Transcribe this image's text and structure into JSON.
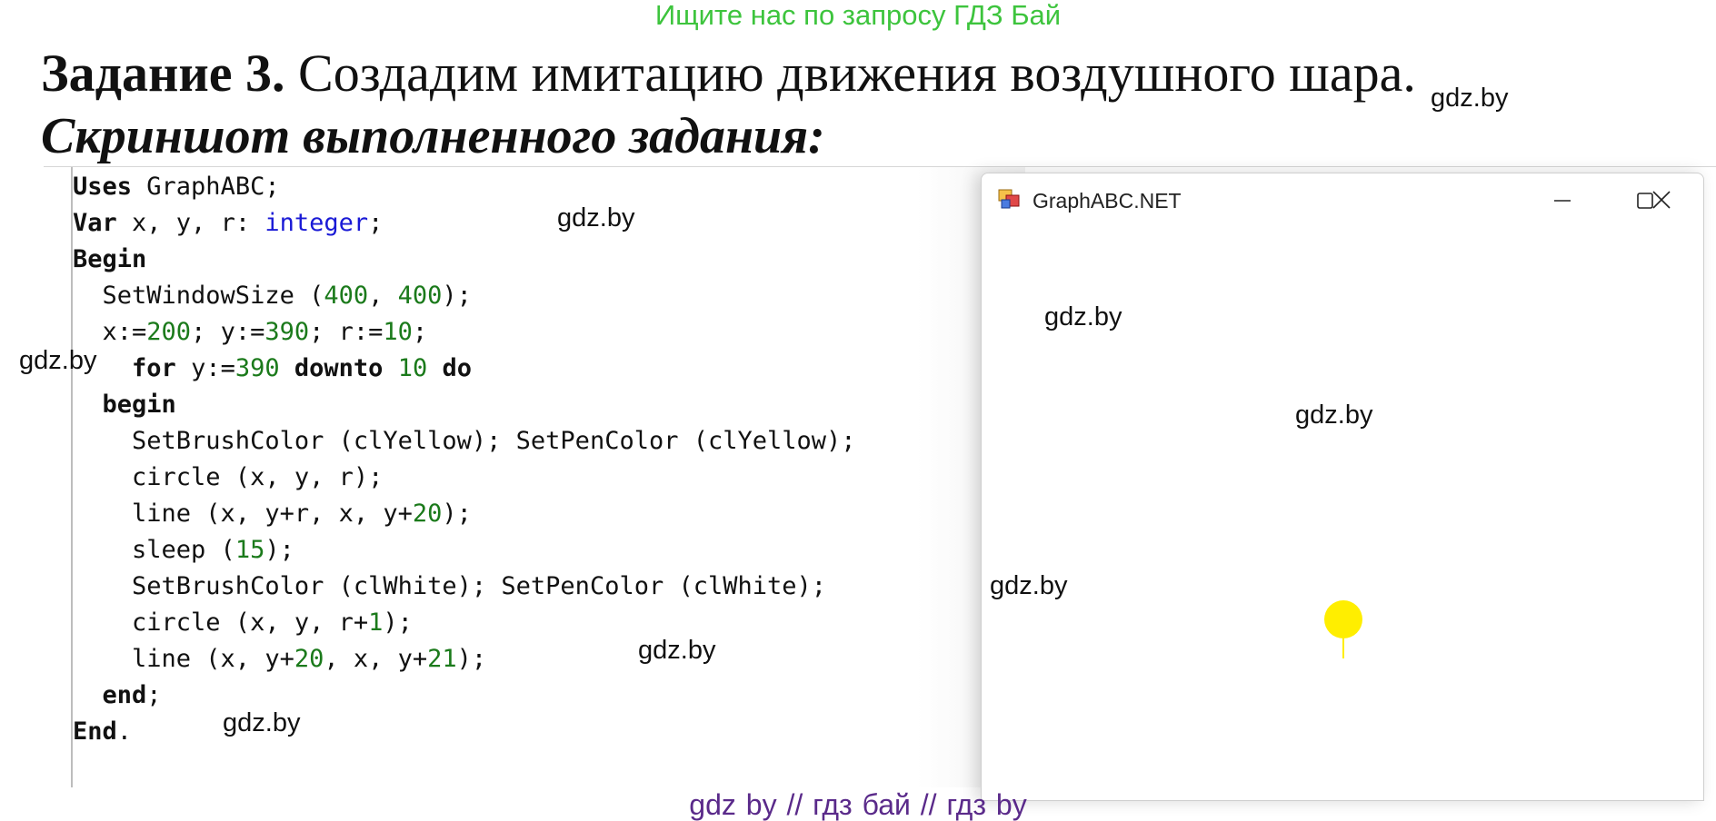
{
  "banner": "Ищите нас по запросу ГДЗ Бай",
  "heading": {
    "bold": "Задание 3.",
    "text": " Создадим имитацию движения воздушного шара."
  },
  "subheading": "Скриншот выполненного задания:",
  "watermark": "gdz.by",
  "footer": "gdz by  //  гдз бай  //  гдз by",
  "editor": {
    "lines": [
      [
        {
          "t": "Uses",
          "c": "kw"
        },
        {
          "t": " GraphABC;",
          "c": ""
        }
      ],
      [
        {
          "t": "Var",
          "c": "kw"
        },
        {
          "t": " x, y, r: ",
          "c": ""
        },
        {
          "t": "integer",
          "c": "ty"
        },
        {
          "t": ";",
          "c": ""
        }
      ],
      [
        {
          "t": "Begin",
          "c": "kw"
        }
      ],
      [
        {
          "t": "  SetWindowSize (",
          "c": ""
        },
        {
          "t": "400",
          "c": "num"
        },
        {
          "t": ", ",
          "c": ""
        },
        {
          "t": "400",
          "c": "num"
        },
        {
          "t": ");",
          "c": ""
        }
      ],
      [
        {
          "t": "  x:=",
          "c": ""
        },
        {
          "t": "200",
          "c": "num"
        },
        {
          "t": "; y:=",
          "c": ""
        },
        {
          "t": "390",
          "c": "num"
        },
        {
          "t": "; r:=",
          "c": ""
        },
        {
          "t": "10",
          "c": "num"
        },
        {
          "t": ";",
          "c": ""
        }
      ],
      [
        {
          "t": "    ",
          "c": ""
        },
        {
          "t": "for",
          "c": "kw"
        },
        {
          "t": " y:=",
          "c": ""
        },
        {
          "t": "390",
          "c": "num"
        },
        {
          "t": " ",
          "c": ""
        },
        {
          "t": "downto",
          "c": "kw"
        },
        {
          "t": " ",
          "c": ""
        },
        {
          "t": "10",
          "c": "num"
        },
        {
          "t": " ",
          "c": ""
        },
        {
          "t": "do",
          "c": "kw"
        }
      ],
      [
        {
          "t": "  ",
          "c": ""
        },
        {
          "t": "begin",
          "c": "kw"
        }
      ],
      [
        {
          "t": "    SetBrushColor (clYellow); SetPenColor (clYellow);",
          "c": ""
        }
      ],
      [
        {
          "t": "    circle (x, y, r);",
          "c": ""
        }
      ],
      [
        {
          "t": "    line (x, y+r, x, y+",
          "c": ""
        },
        {
          "t": "20",
          "c": "num"
        },
        {
          "t": ");",
          "c": ""
        }
      ],
      [
        {
          "t": "    sleep (",
          "c": ""
        },
        {
          "t": "15",
          "c": "num"
        },
        {
          "t": ");",
          "c": ""
        }
      ],
      [
        {
          "t": "    SetBrushColor (clWhite); SetPenColor (clWhite);",
          "c": ""
        }
      ],
      [
        {
          "t": "    circle (x, y, r+",
          "c": ""
        },
        {
          "t": "1",
          "c": "num"
        },
        {
          "t": ");",
          "c": ""
        }
      ],
      [
        {
          "t": "    line (x, y+",
          "c": ""
        },
        {
          "t": "20",
          "c": "num"
        },
        {
          "t": ", x, y+",
          "c": ""
        },
        {
          "t": "21",
          "c": "num"
        },
        {
          "t": ");",
          "c": ""
        }
      ],
      [
        {
          "t": "  ",
          "c": ""
        },
        {
          "t": "end",
          "c": "kw"
        },
        {
          "t": ";",
          "c": ""
        }
      ],
      [
        {
          "t": "End",
          "c": "kw"
        },
        {
          "t": ".",
          "c": ""
        }
      ]
    ]
  },
  "graph_window": {
    "title": "GraphABC.NET",
    "balloon_color": "#ffee00"
  }
}
